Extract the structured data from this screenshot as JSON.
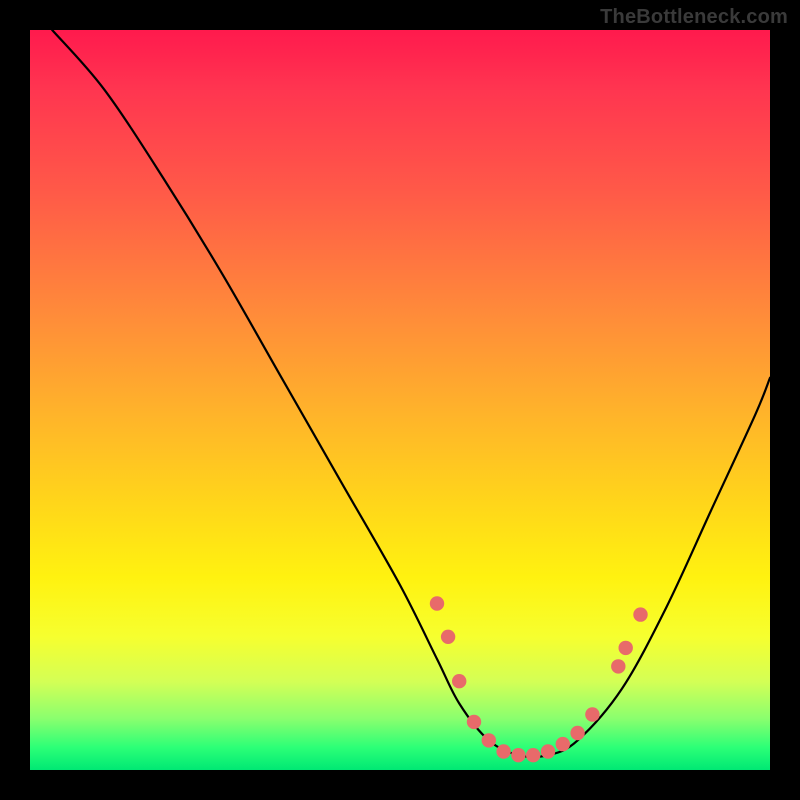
{
  "watermark": "TheBottleneck.com",
  "colors": {
    "gradient_top": "#ff1a4d",
    "gradient_mid": "#ffd61a",
    "gradient_bottom": "#00e874",
    "curve": "#000000",
    "dots": "#e86a6a",
    "frame": "#000000"
  },
  "chart_data": {
    "type": "line",
    "title": "",
    "xlabel": "",
    "ylabel": "",
    "xlim": [
      0,
      100
    ],
    "ylim": [
      0,
      100
    ],
    "grid": false,
    "legend": false,
    "series": [
      {
        "name": "bottleneck-curve",
        "x": [
          3,
          10,
          18,
          26,
          34,
          42,
          50,
          55,
          58,
          62,
          66,
          70,
          74,
          80,
          86,
          92,
          98,
          100
        ],
        "y": [
          100,
          92,
          80,
          67,
          53,
          39,
          25,
          15,
          9,
          4,
          2,
          2,
          4,
          11,
          22,
          35,
          48,
          53
        ]
      }
    ],
    "markers": [
      {
        "x": 55.0,
        "y": 22.5
      },
      {
        "x": 56.5,
        "y": 18.0
      },
      {
        "x": 58.0,
        "y": 12.0
      },
      {
        "x": 60.0,
        "y": 6.5
      },
      {
        "x": 62.0,
        "y": 4.0
      },
      {
        "x": 64.0,
        "y": 2.5
      },
      {
        "x": 66.0,
        "y": 2.0
      },
      {
        "x": 68.0,
        "y": 2.0
      },
      {
        "x": 70.0,
        "y": 2.5
      },
      {
        "x": 72.0,
        "y": 3.5
      },
      {
        "x": 74.0,
        "y": 5.0
      },
      {
        "x": 76.0,
        "y": 7.5
      },
      {
        "x": 79.5,
        "y": 14.0
      },
      {
        "x": 80.5,
        "y": 16.5
      },
      {
        "x": 82.5,
        "y": 21.0
      }
    ]
  }
}
